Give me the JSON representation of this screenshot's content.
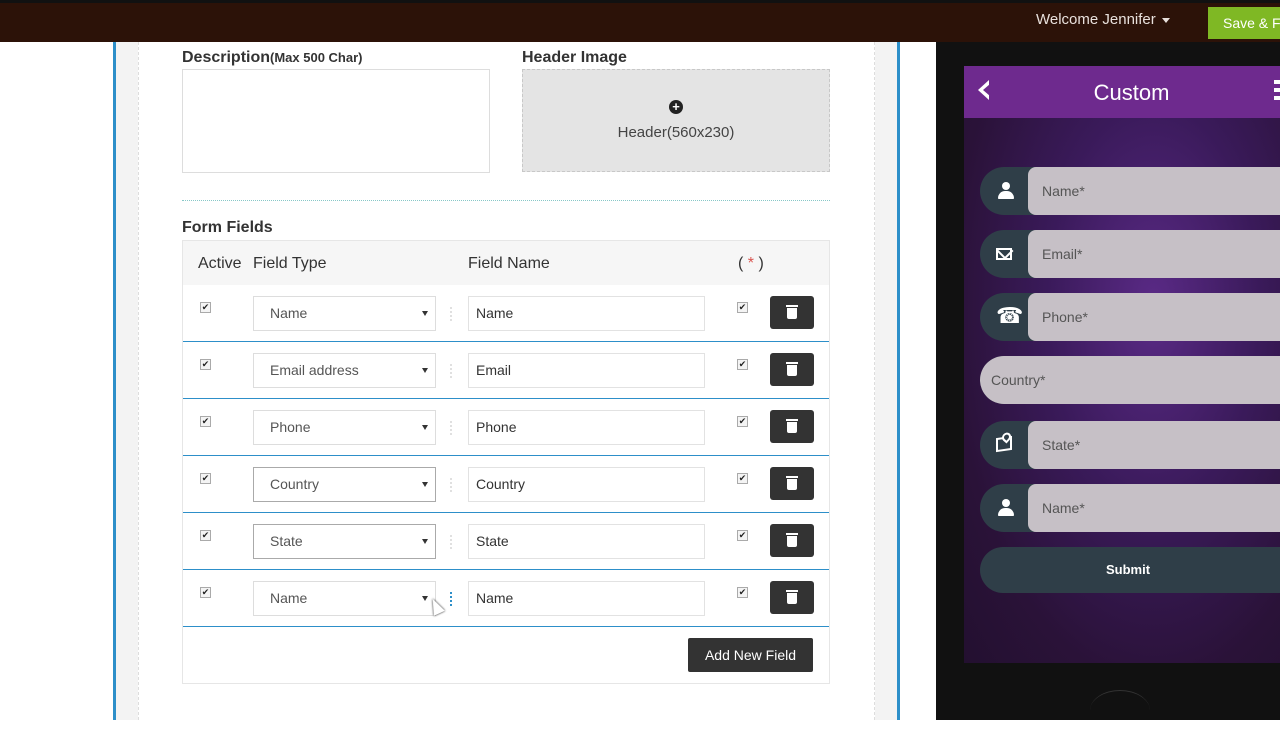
{
  "topbar": {
    "welcome": "Welcome Jennifer",
    "save_label": "Save & Fi"
  },
  "editor": {
    "description_label": "Description",
    "description_hint": "(Max 500 Char)",
    "header_image_label": "Header Image",
    "header_placeholder": "Header(560x230)",
    "form_fields_title": "Form Fields",
    "columns": {
      "active": "Active",
      "field_type": "Field Type",
      "field_name": "Field Name",
      "required_open": "( ",
      "required_star": "*",
      "required_close": " )"
    },
    "rows": [
      {
        "type": "Name",
        "name": "Name"
      },
      {
        "type": "Email address",
        "name": "Email"
      },
      {
        "type": "Phone",
        "name": "Phone"
      },
      {
        "type": "Country",
        "name": "Country"
      },
      {
        "type": "State",
        "name": "State"
      },
      {
        "type": "Name",
        "name": "Name"
      }
    ],
    "add_field_label": "Add New Field"
  },
  "preview": {
    "title": "Custom",
    "fields": [
      "Name*",
      "Email*",
      "Phone*",
      "Country*",
      "State*",
      "Name*"
    ],
    "submit_label": "Submit"
  },
  "colors": {
    "accent": "#2d8fc9",
    "save_green": "#7fb824",
    "phone_header": "#6e2a8e",
    "field_pill": "#2f3e48"
  }
}
